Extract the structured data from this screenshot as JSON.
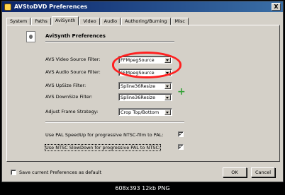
{
  "window": {
    "title": "AVStoDVD Preferences",
    "close_glyph": "X"
  },
  "tabs": [
    {
      "label": "System",
      "active": false
    },
    {
      "label": "Paths",
      "active": false
    },
    {
      "label": "AviSynth",
      "active": true
    },
    {
      "label": "Video",
      "active": false
    },
    {
      "label": "Audio",
      "active": false
    },
    {
      "label": "Authoring/Burning",
      "active": false
    },
    {
      "label": "Misc",
      "active": false
    }
  ],
  "panel": {
    "title": "AviSynth Preferences",
    "fields": [
      {
        "label": "AVS Video Source Filter:",
        "value": "FFMpegSource"
      },
      {
        "label": "AVS Audio Source Filter:",
        "value": "FFMpegSource"
      },
      {
        "label": "AVS UpSize Filter:",
        "value": "Spline36Resize"
      },
      {
        "label": "AVS DownSize Filter:",
        "value": "Spline36Resize"
      },
      {
        "label": "Adjust Frame Strategy:",
        "value": "Crop Top/Bottom"
      }
    ],
    "options": [
      {
        "label": "Use PAL SpeedUp for progressive NTSC-film to PAL:",
        "checked": true,
        "mark": "✓"
      },
      {
        "label": "Use NTSC SlowDown for progressive PAL to NTSC:",
        "checked": true,
        "mark": "✓"
      }
    ],
    "plus_glyph": "+"
  },
  "footer": {
    "save_label": "Save current Preferences as default",
    "save_checked": false,
    "ok_label": "OK",
    "cancel_label": "Cancel"
  },
  "caption": "608x393 12kb PNG",
  "colors": {
    "titlebar_start": "#0a246a",
    "titlebar_end": "#3a6ea5",
    "annotation": "#ff2020",
    "plus": "#37a33a"
  }
}
